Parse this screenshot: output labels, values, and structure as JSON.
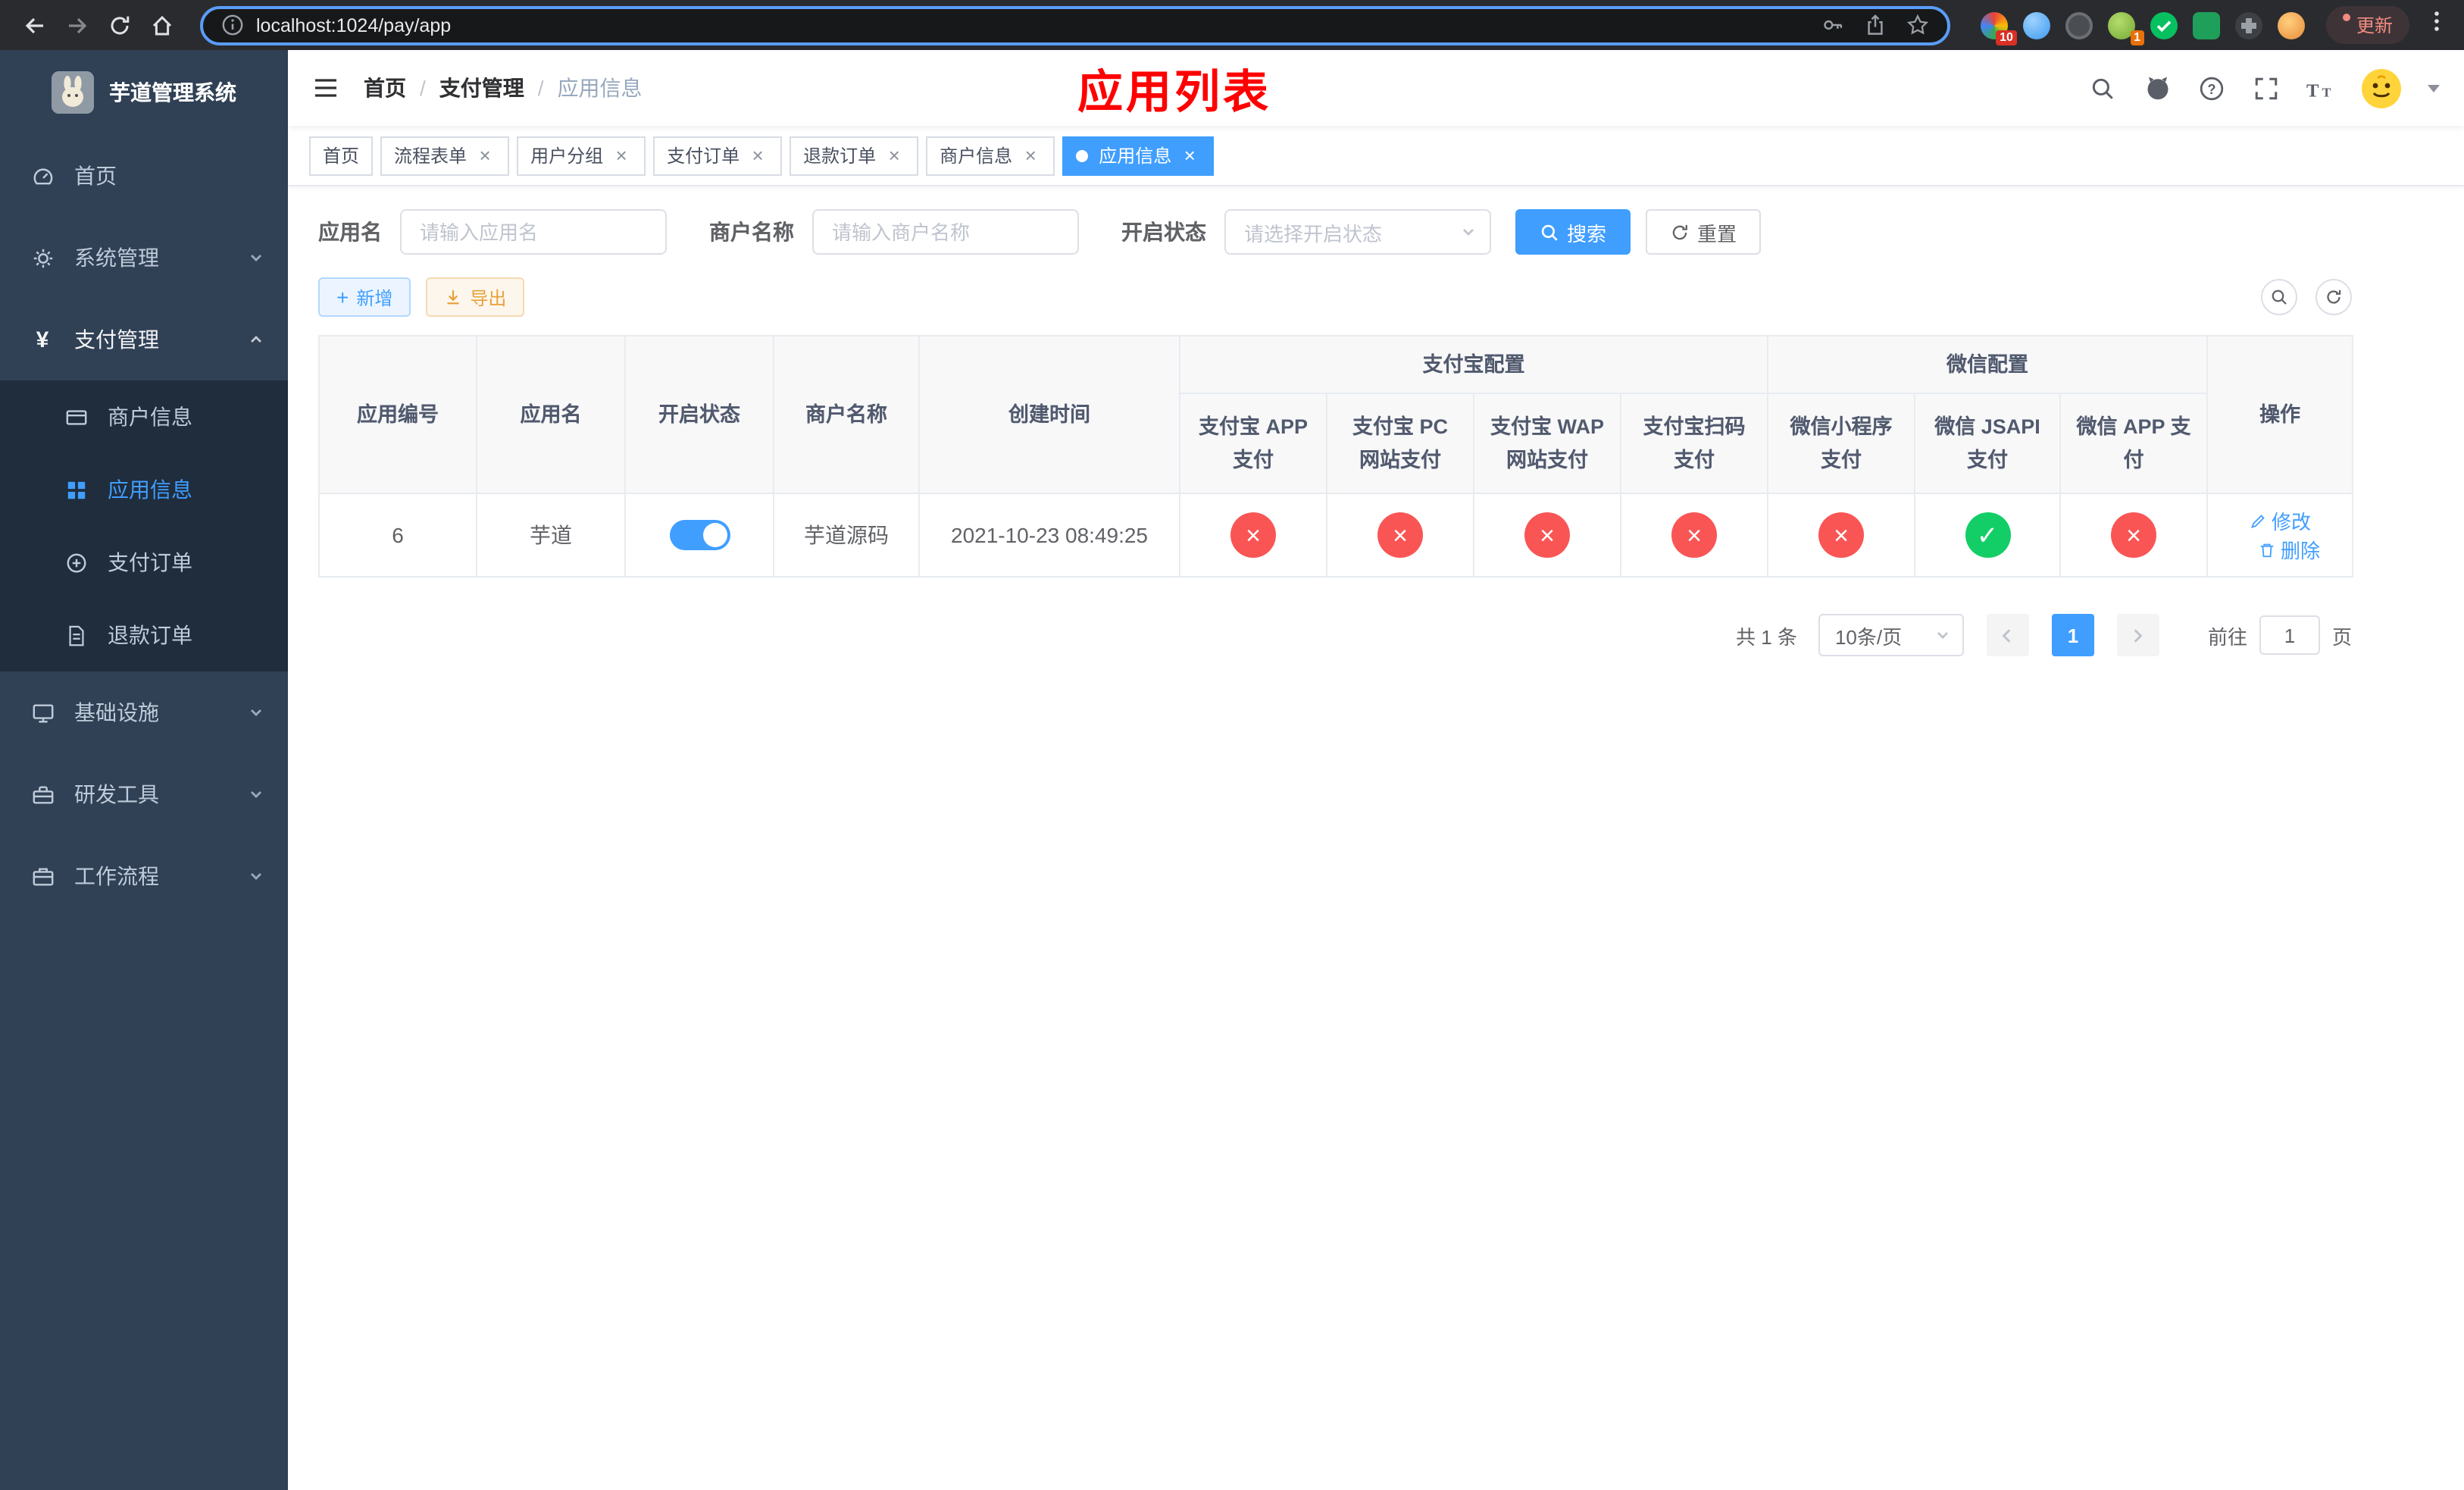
{
  "browser": {
    "url": "localhost:1024/pay/app",
    "update_label": "更新",
    "ext_badge_1": "10",
    "ext_badge_2": "1"
  },
  "colors": {
    "accent": "#409eff",
    "success": "#13ce66",
    "danger": "#fa5555",
    "warning": "#e6a23c",
    "title_red": "#ff0000",
    "sidebar_bg": "#304156",
    "submenu_bg": "#1f2d3d"
  },
  "sidebar": {
    "title": "芋道管理系统",
    "home": "首页",
    "system": "系统管理",
    "pay": "支付管理",
    "merchant": "商户信息",
    "app": "应用信息",
    "order": "支付订单",
    "refund": "退款订单",
    "infra": "基础设施",
    "devtools": "研发工具",
    "workflow": "工作流程",
    "currency_icon": "¥"
  },
  "header": {
    "breadcrumb": [
      "首页",
      "支付管理",
      "应用信息"
    ],
    "separator": "/",
    "page_title": "应用列表"
  },
  "tabs": [
    {
      "label": "首页"
    },
    {
      "label": "流程表单"
    },
    {
      "label": "用户分组"
    },
    {
      "label": "支付订单"
    },
    {
      "label": "退款订单"
    },
    {
      "label": "商户信息"
    },
    {
      "label": "应用信息"
    }
  ],
  "filters": {
    "app_name_label": "应用名",
    "app_name_placeholder": "请输入应用名",
    "merchant_label": "商户名称",
    "merchant_placeholder": "请输入商户名称",
    "status_label": "开启状态",
    "status_placeholder": "请选择开启状态",
    "search_label": "搜索",
    "reset_label": "重置"
  },
  "toolbar": {
    "add_label": "新增",
    "export_label": "导出"
  },
  "table": {
    "cols": {
      "id": "应用编号",
      "name": "应用名",
      "status": "开启状态",
      "merchant": "商户名称",
      "created": "创建时间",
      "op": "操作"
    },
    "groups": {
      "alipay": "支付宝配置",
      "wechat": "微信配置"
    },
    "subcols": {
      "a1": "支付宝 APP 支付",
      "a2": "支付宝 PC 网站支付",
      "a3": "支付宝 WAP 网站支付",
      "a4": "支付宝扫码支付",
      "w1": "微信小程序支付",
      "w2": "微信 JSAPI 支付",
      "w3": "微信 APP 支付"
    },
    "row": {
      "id": "6",
      "name": "芋道",
      "status_on": true,
      "merchant": "芋道源码",
      "created": "2021-10-23 08:49:25",
      "pay_configs": {
        "alipay_app": false,
        "alipay_pc": false,
        "alipay_wap": false,
        "alipay_qr": false,
        "wx_lite": false,
        "wx_jsapi": true,
        "wx_app": false
      }
    },
    "ops": {
      "edit": "修改",
      "del": "删除"
    }
  },
  "icons": {
    "fail": "×",
    "ok": "✓",
    "close": "×",
    "plus": "+"
  },
  "pagination": {
    "total": "共 1 条",
    "page_size": "10条/页",
    "current_page": "1",
    "goto_label": "前往",
    "goto_value": "1",
    "page_unit": "页"
  }
}
